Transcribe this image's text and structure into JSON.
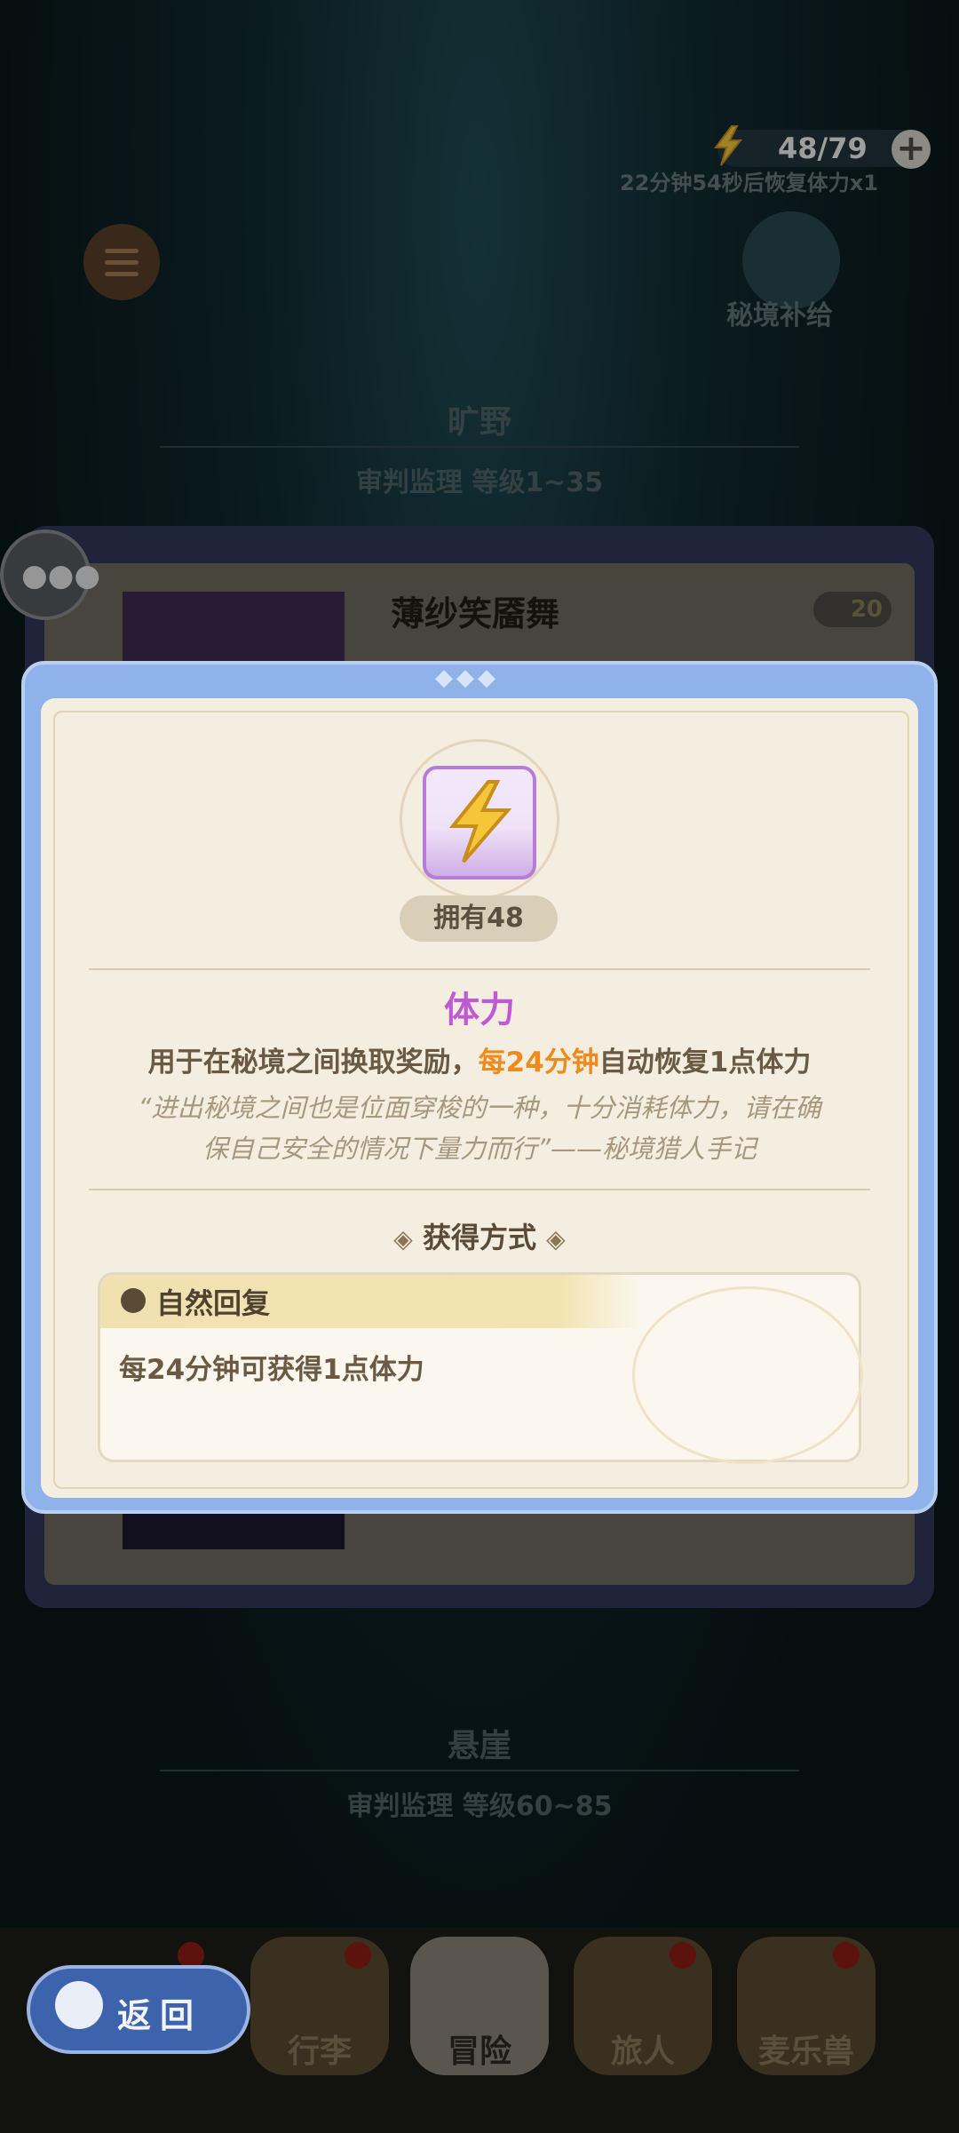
{
  "top_bar": {
    "stamina_value": "48/79",
    "recover_text": "22分钟54秒后恢复体力x1",
    "plus_icon": "+",
    "supply_label": "秘境补给"
  },
  "zones": [
    {
      "name": "旷野",
      "subtitle": "审判监理  等级1~35"
    },
    {
      "name": "悬崖",
      "subtitle": "审判监理  等级60~85"
    }
  ],
  "level_card": {
    "name": "薄纱笑靥舞",
    "cost": "20"
  },
  "modal": {
    "owned": "拥有48",
    "item_name": "体力",
    "desc_prefix": "用于在秘境之间换取奖励，",
    "desc_highlight": "每24分钟",
    "desc_suffix": "自动恢复1点体力",
    "quote_line1": "“进出秘境之间也是位面穿梭的一种，十分消耗体力，请在确",
    "quote_line2": "保自己安全的情况下量力而行”——秘境猎人手记",
    "obtain_title": "获得方式",
    "source_name": "自然回复",
    "source_text": "每24分钟可获得1点体力"
  },
  "bottom_nav": [
    {
      "label": "行李"
    },
    {
      "label": "冒险",
      "active": true
    },
    {
      "label": "旅人"
    },
    {
      "label": "麦乐兽"
    }
  ],
  "back_button": {
    "label": "返回"
  },
  "colors": {
    "accent_purple": "#c05ad4",
    "accent_orange": "#ef8a1c",
    "modal_frame": "#8fb2ea"
  }
}
